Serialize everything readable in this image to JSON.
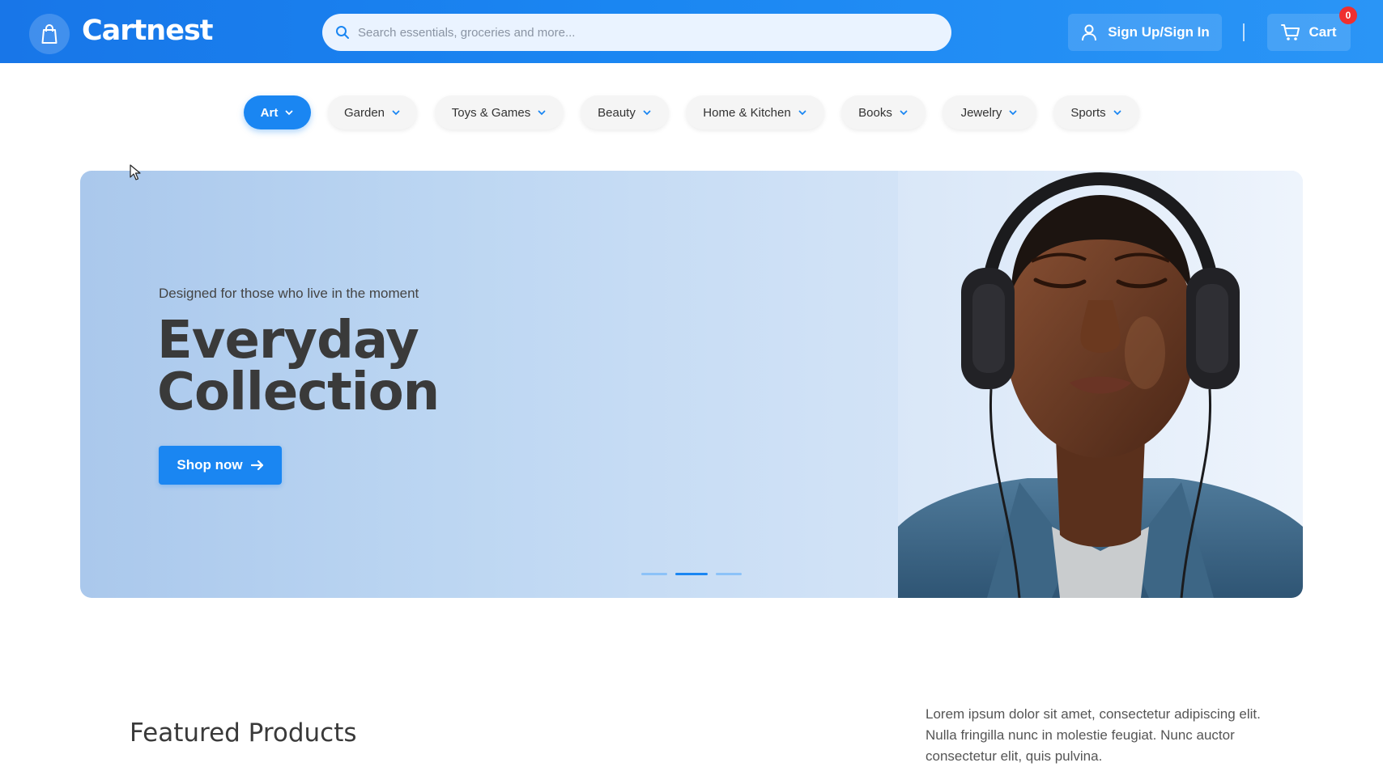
{
  "header": {
    "brand": "Cartnest",
    "search_placeholder": "Search essentials, groceries and more...",
    "signin_label": "Sign Up/Sign In",
    "cart_label": "Cart",
    "cart_count": "0"
  },
  "categories": [
    {
      "label": "Art",
      "active": true
    },
    {
      "label": "Garden"
    },
    {
      "label": "Toys & Games"
    },
    {
      "label": "Beauty"
    },
    {
      "label": "Home & Kitchen"
    },
    {
      "label": "Books"
    },
    {
      "label": "Jewelry"
    },
    {
      "label": "Sports"
    }
  ],
  "hero": {
    "subtitle": "Designed for those who live in the moment",
    "title_line1": "Everyday",
    "title_line2": "Collection",
    "cta_label": "Shop now",
    "slide_count": 3,
    "active_slide": 2
  },
  "featured": {
    "title": "Featured Products",
    "description": "Lorem ipsum dolor sit amet, consectetur adipiscing elit. Nulla fringilla nunc in molestie feugiat. Nunc auctor consectetur elit, quis pulvina."
  },
  "colors": {
    "primary": "#1a86f2",
    "header_gradient_start": "#1876e8",
    "badge": "#ef2f2f"
  },
  "icons": {
    "logo": "shopping-bag-icon",
    "search": "search-icon",
    "user": "user-icon",
    "cart": "cart-icon",
    "arrow": "arrow-right-icon",
    "chevron": "chevron-down-icon"
  }
}
